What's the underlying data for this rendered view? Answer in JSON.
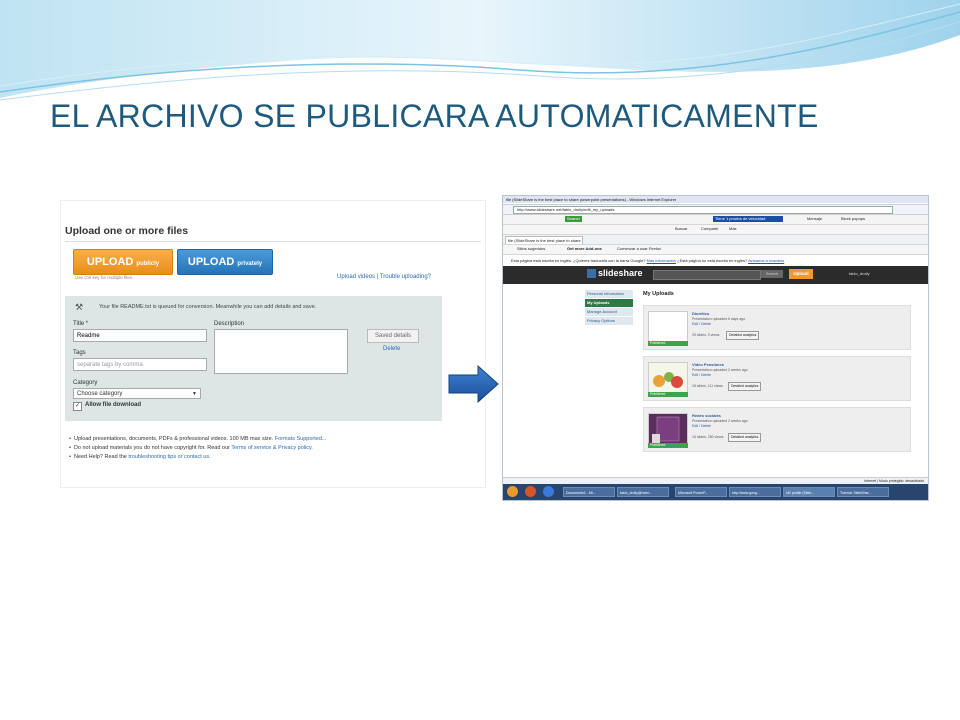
{
  "slide": {
    "title": "EL ARCHIVO SE PUBLICARA AUTOMATICAMENTE"
  },
  "upload_page": {
    "heading": "Upload one or more files",
    "upload_public": "UPLOAD",
    "upload_public_suffix": "publicly",
    "upload_private": "UPLOAD",
    "upload_private_suffix": "privately",
    "ctrl_tip": "Use Ctrl key for multiple files.",
    "help_links": "Upload videos | Trouble uploading?",
    "queued_msg": "Your file README.txt is queued for conversion. Meanwhile you can add details and save.",
    "title_label": "Title *",
    "title_value": "Readme",
    "description_label": "Description",
    "tags_label": "Tags",
    "tags_placeholder": "separate tags by comma",
    "category_label": "Category",
    "category_value": "Choose category",
    "allow_download": "Allow file download",
    "saved_details": "Saved details",
    "delete": "Delete",
    "notes": [
      {
        "text": "Upload presentations, documents, PDFs & professional videos. 100 MB max size.",
        "link": "Formats Supported..."
      },
      {
        "text": "Do not upload materials you do not have copyright for. Read our",
        "link": "Terms of service & Privacy policy."
      },
      {
        "text": "Need Help? Read the",
        "link": "troubleshooting tips or contact us."
      }
    ]
  },
  "browser": {
    "window_title": "file (SlideShare is the best place to share powerpoint presentations) - Windows Internet Explorer",
    "address": "http://www.slideshare.net/fabio_drolly/edit_my_uploads",
    "toolbar_speed": "Tiene 1 prueba de velocidad",
    "toolbar_block": "Block popups",
    "toolbar_msg": "Mensaje",
    "search_label": "Buscar",
    "share_label": "Compartir",
    "more_label": "Más",
    "tab_title": "file (SlideShare is the best place to share p...",
    "cmd_sites": "Sitios sugeridos",
    "cmd_addons": "Get more Add-ons",
    "cmd_firefox": "Comenzar a usar Firefox",
    "translate_msg": "Esta página está escrita en inglés. ¿Quieres traducirla con la barra Google?",
    "translate_link": "Más información",
    "translate_tail": "¿Está página no está escrita en inglés?",
    "translate_tail_link": "Avísanos a nosotros",
    "logo": "slideshare",
    "search_btn": "Search",
    "upload_btn": "Upload",
    "user_name": "fabio_drolly",
    "sidebar": [
      "Personal Information",
      "My Uploads",
      "Manage Account",
      "Privacy Options"
    ],
    "my_uploads_title": "My Uploads",
    "uploads": [
      {
        "title": "Diurético",
        "meta": "Presentation uploaded 6 days ago",
        "edit": "Edit / Delete",
        "stats": "29 slides, 0 views",
        "button": "Detailed analytics",
        "status": "Published"
      },
      {
        "title": "Video Pensiónes",
        "meta": "Presentation uploaded 2 weeks ago",
        "edit": "Edit / Delete",
        "stats": "15 slides, 111 views",
        "button": "Detailed analytics",
        "status": "Published"
      },
      {
        "title": "Redes sociales",
        "meta": "Presentation uploaded 2 weeks ago",
        "edit": "Edit / Delete",
        "stats": "16 slides, 250 views",
        "button": "Detailed analytics",
        "status": "Published"
      }
    ],
    "statusbar": "Internet | Modo protegido: desactivado",
    "taskbar": [
      "Documento1 - Mi...",
      "fabio_drolly@hotm...",
      "Microsoft PowerP...",
      "http://www.goog...",
      "UK profile (Slide...",
      "Tutorial: SlideShar..."
    ]
  },
  "colors": {
    "title": "#1e5a7e",
    "upload_public": "#f09a2b",
    "upload_private": "#2674b9",
    "arrow": "#1f5fb2",
    "published": "#3fa34d"
  }
}
